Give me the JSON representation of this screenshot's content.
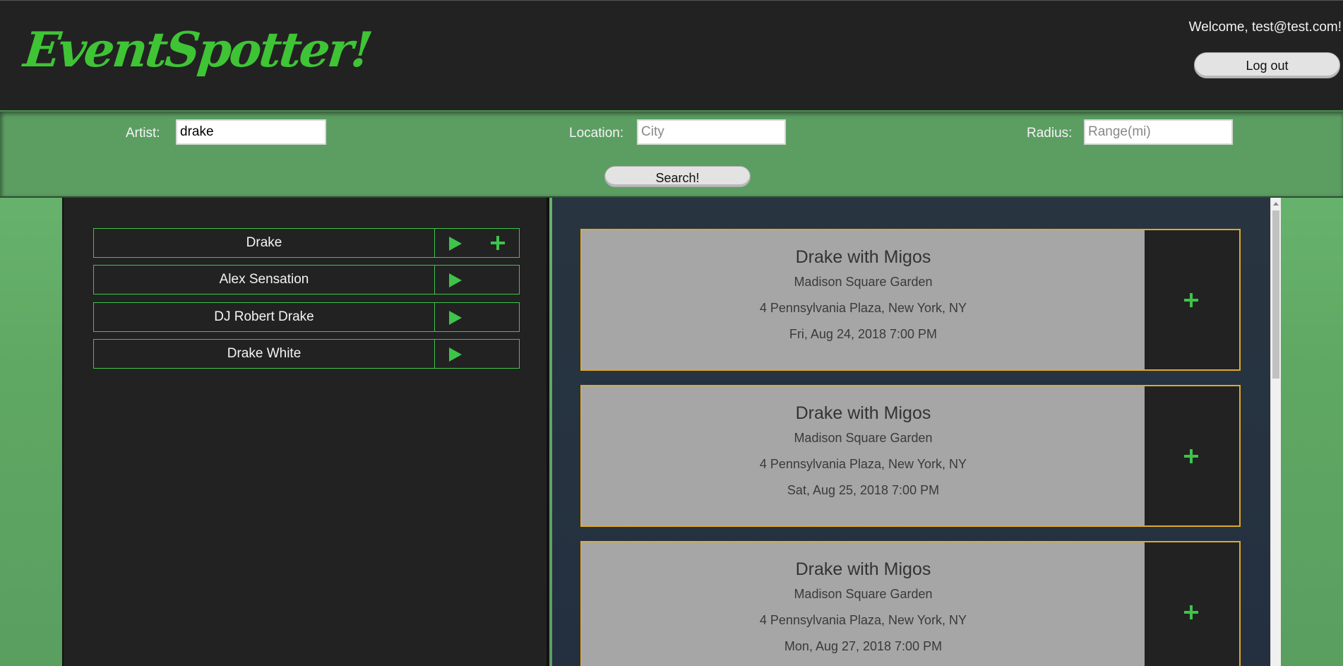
{
  "header": {
    "logo": "EventSpotter!",
    "welcome": "Welcome, test@test.com!",
    "logout_label": "Log out"
  },
  "search": {
    "artist_label": "Artist:",
    "artist_value": "drake",
    "location_label": "Location:",
    "location_placeholder": "City",
    "radius_label": "Radius:",
    "radius_placeholder": "Range(mi)",
    "search_label": "Search!"
  },
  "artists": [
    {
      "name": "Drake",
      "has_add": true
    },
    {
      "name": "Alex Sensation",
      "has_add": false
    },
    {
      "name": "DJ Robert Drake",
      "has_add": false
    },
    {
      "name": "Drake White",
      "has_add": false
    }
  ],
  "events": [
    {
      "title": "Drake with Migos",
      "venue": "Madison Square Garden",
      "address": "4 Pennsylvania Plaza, New York, NY",
      "date": "Fri, Aug 24, 2018 7:00 PM"
    },
    {
      "title": "Drake with Migos",
      "venue": "Madison Square Garden",
      "address": "4 Pennsylvania Plaza, New York, NY",
      "date": "Sat, Aug 25, 2018 7:00 PM"
    },
    {
      "title": "Drake with Migos",
      "venue": "Madison Square Garden",
      "address": "4 Pennsylvania Plaza, New York, NY",
      "date": "Mon, Aug 27, 2018 7:00 PM"
    }
  ],
  "colors": {
    "accent_green": "#3ec44a",
    "logo_green": "#3fc435",
    "card_border": "#e0a928",
    "dark_bg": "#222222",
    "search_bar_bg": "#5c9e62"
  },
  "icons": {
    "play": "play-icon",
    "add": "plus-icon"
  }
}
